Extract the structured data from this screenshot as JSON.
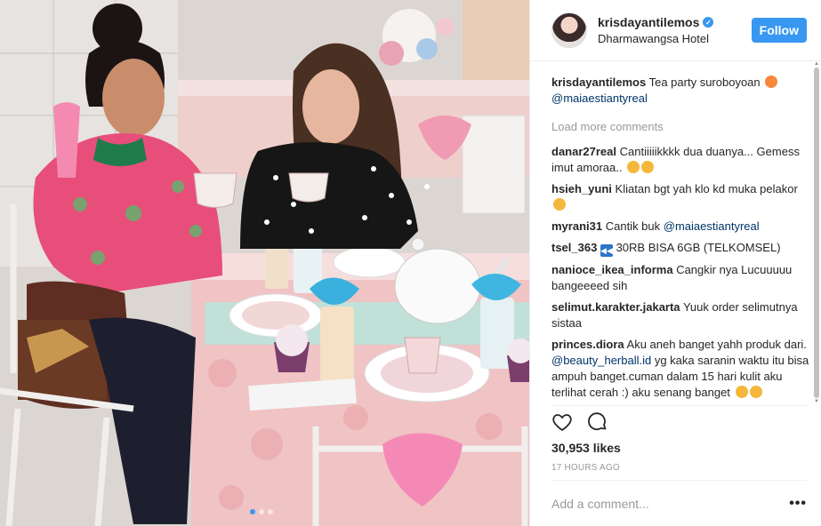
{
  "post": {
    "username": "krisdayantilemos",
    "location": "Dharmawangsa Hotel",
    "follow_label": "Follow",
    "likes": "30,953 likes",
    "time": "17 HOURS AGO",
    "comment_placeholder": "Add a comment...",
    "more_label": "•••",
    "carousel_count": 3,
    "carousel_active": 1
  },
  "caption": {
    "user": "krisdayantilemos",
    "text": "Tea party suroboyoan",
    "mention": "@maiaestiantyreal"
  },
  "load_more": "Load more comments",
  "comments": [
    {
      "user": "danar27real",
      "text": "Cantiiiiikkkk dua duanya... Gemess imut amoraa.."
    },
    {
      "user": "hsieh_yuni",
      "text": "Kliatan bgt yah klo kd muka pelakor"
    },
    {
      "user": "myrani31",
      "text": "Cantik buk",
      "mention": "@maiaestiantyreal"
    },
    {
      "user": "tsel_363",
      "text": "30RB BISA 6GB (TELKOMSEL)"
    },
    {
      "user": "nanioce_ikea_informa",
      "text": "Cangkir nya Lucuuuuu bangeeeed sih"
    },
    {
      "user": "selimut.karakter.jakarta",
      "text": "Yuuk order selimutnya sistaa"
    },
    {
      "user": "princes.diora",
      "text": "Aku aneh banget yahh produk dari.",
      "mention": "@beauty_herball.id",
      "text2": "yg kaka saranin waktu itu bisa ampuh banget.cuman dalam 15 hari kulit aku terlihat cerah :) aku senang banget"
    }
  ],
  "colors": {
    "accent": "#3897f0",
    "mention": "#003569",
    "muted": "#999999"
  }
}
